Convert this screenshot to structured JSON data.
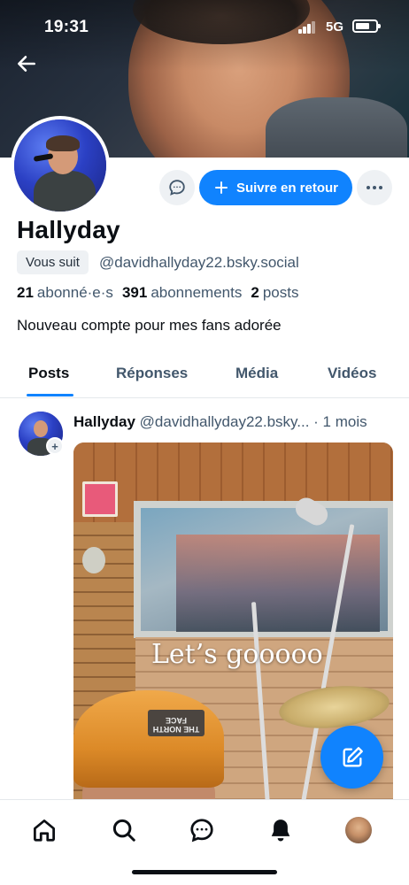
{
  "status_bar": {
    "time": "19:31",
    "network": "5G",
    "battery_level": 0.7
  },
  "profile": {
    "display_name": "Hallyday",
    "follows_you_label": "Vous suit",
    "handle": "@davidhallyday22.bsky.social",
    "stats": {
      "followers_count": "21",
      "followers_label": "abonné·e·s",
      "following_count": "391",
      "following_label": "abonnements",
      "posts_count": "2",
      "posts_label": "posts"
    },
    "bio": "Nouveau compte pour mes fans adorée"
  },
  "actions": {
    "follow_back_label": "Suivre en retour",
    "message_icon": "chat-bubble-icon",
    "more_icon": "ellipsis-icon"
  },
  "tabs": [
    {
      "label": "Posts",
      "active": true
    },
    {
      "label": "Réponses",
      "active": false
    },
    {
      "label": "Média",
      "active": false
    },
    {
      "label": "Vidéos",
      "active": false
    }
  ],
  "post": {
    "author": "Hallyday",
    "handle": "@davidhallyday22.bsky...",
    "separator": " · ",
    "time": "1 mois",
    "image_overlay_text": "Let’s gooooo",
    "cap_logo_text": "THE NORTH FACE"
  },
  "bottom_nav": [
    "home-icon",
    "search-icon",
    "messages-icon",
    "notifications-icon",
    "profile-avatar"
  ],
  "colors": {
    "accent": "#1083fe",
    "text_primary": "#0b0f14",
    "text_secondary": "#42576c"
  }
}
